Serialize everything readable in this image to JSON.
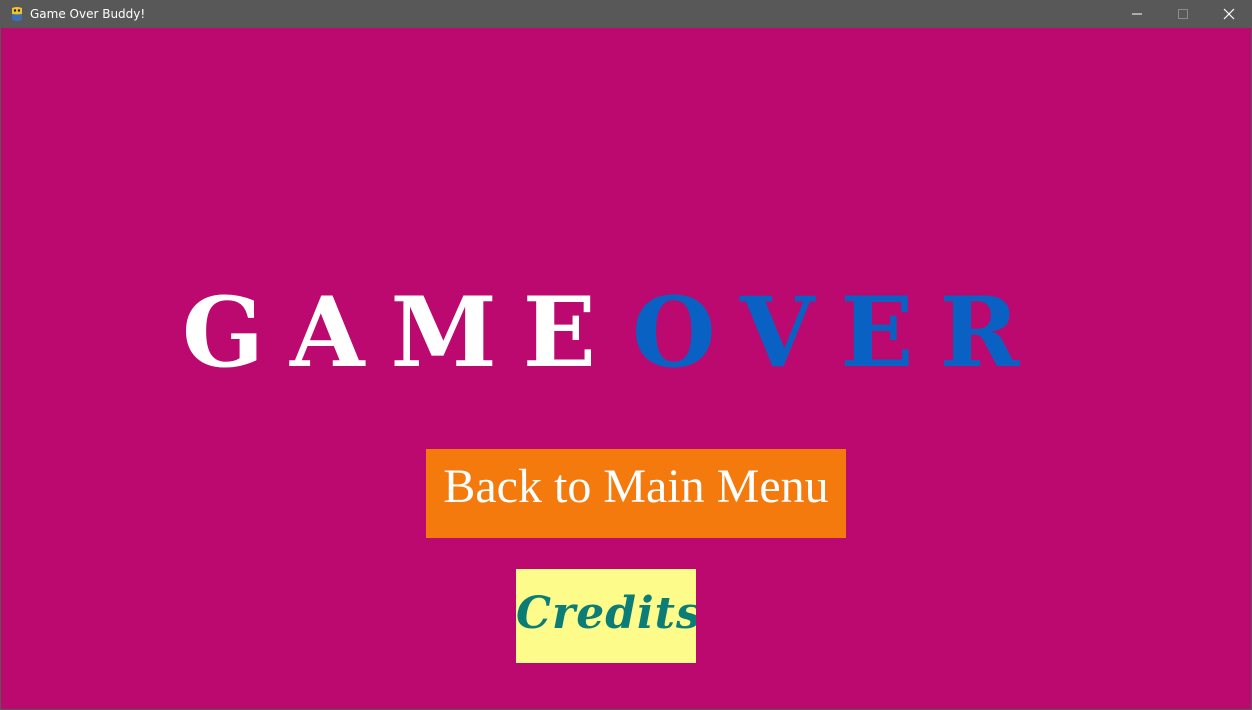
{
  "window": {
    "title": "Game Over Buddy!",
    "icon": "python-snake-icon",
    "controls": [
      "minimize-icon",
      "maximize-icon",
      "close-icon"
    ]
  },
  "game": {
    "background_color": "#bc096f",
    "heading": {
      "word1": "GAME",
      "word1_color": "#ffffff",
      "word2": "OVER",
      "word2_color": "#0a61c4"
    },
    "buttons": {
      "main_menu": {
        "label": "Back to Main Menu",
        "bg": "#f47a0d",
        "color": "#ffffff"
      },
      "credits": {
        "label": "Credits",
        "bg": "#fdfc8a",
        "color": "#0c7c76"
      }
    }
  }
}
